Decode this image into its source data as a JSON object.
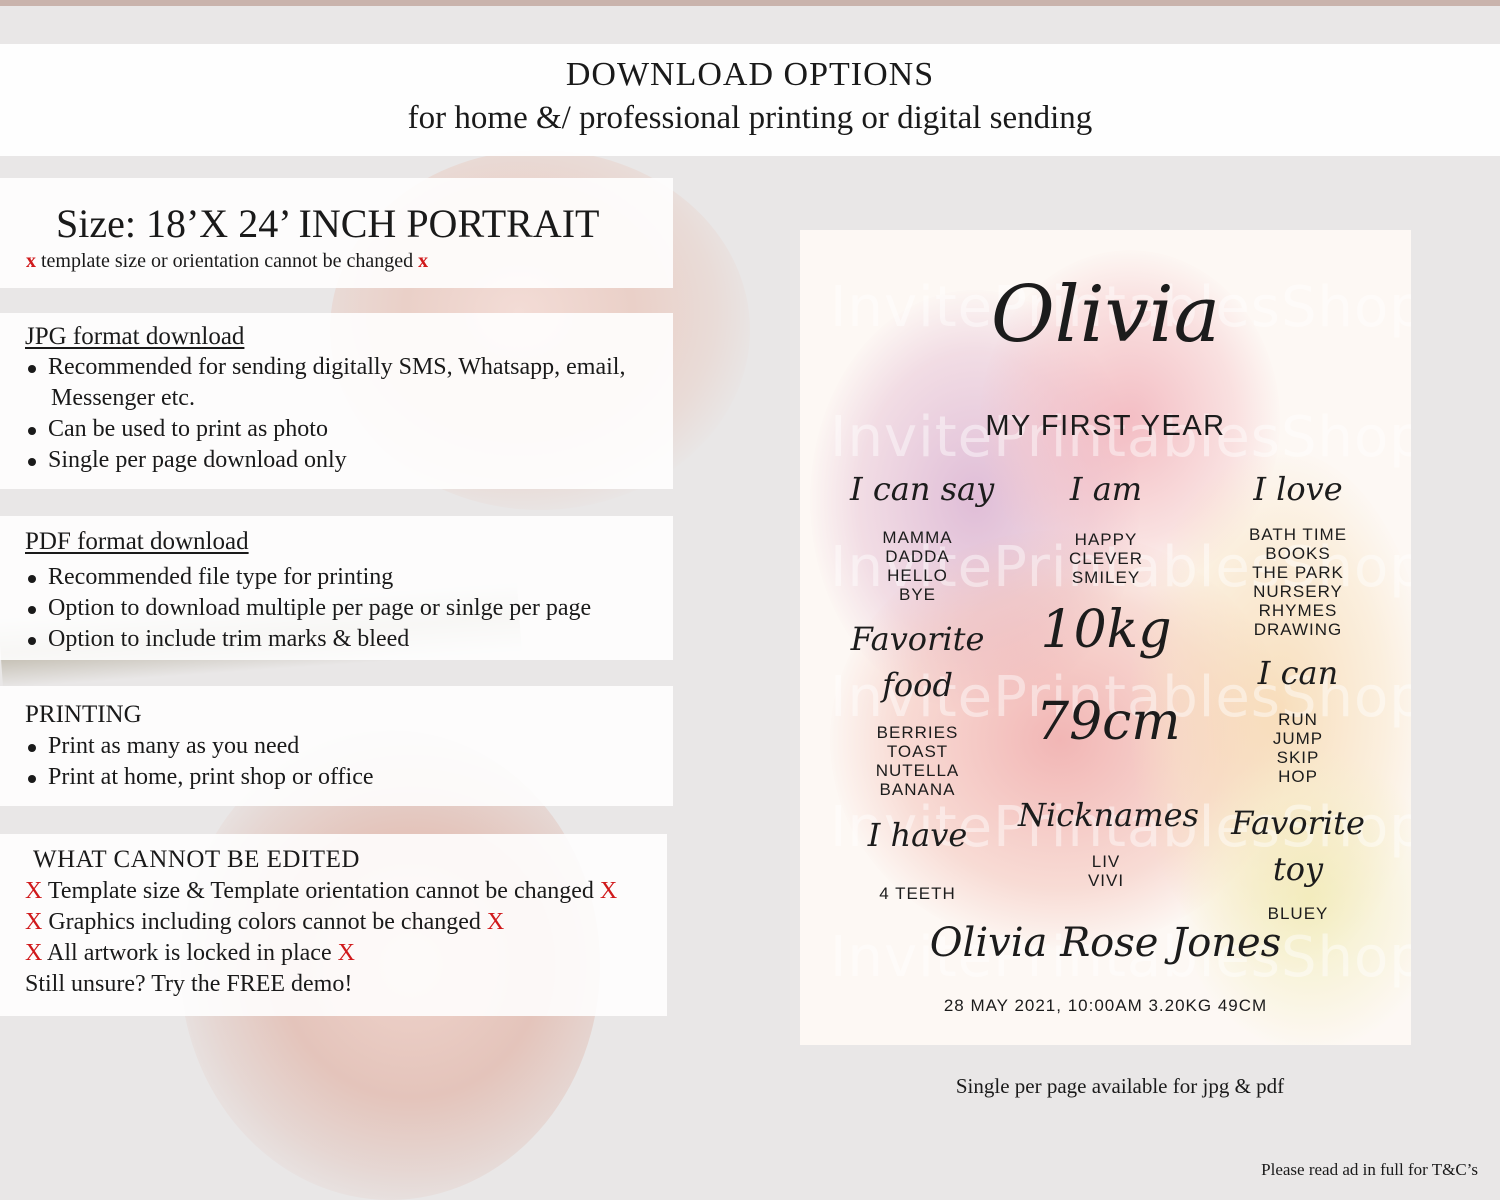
{
  "header": {
    "title": "DOWNLOAD OPTIONS",
    "subtitle": "for home &/ professional printing or digital sending"
  },
  "size_panel": {
    "title": "Size: 18’X 24’ INCH PORTRAIT",
    "mark": "x",
    "note": "template size or orientation cannot be changed"
  },
  "jpg_panel": {
    "title": "JPG format download",
    "items": [
      "Recommended for sending digitally SMS, Whatsapp, email,",
      "Messenger etc.",
      "Can be used to print as photo",
      "Single per page download only"
    ]
  },
  "pdf_panel": {
    "title": "PDF format download",
    "items": [
      "Recommended file type for printing",
      "Option to download multiple per page or sinlge per page",
      "Option to include trim marks & bleed"
    ]
  },
  "printing_panel": {
    "title": "PRINTING",
    "items": [
      "Print as many as you need",
      "Print at home, print shop or office"
    ]
  },
  "edit_panel": {
    "title": "WHAT CANNOT BE EDITED",
    "mark": "X",
    "items": [
      "Template size & Template orientation cannot be changed",
      "Graphics including colors cannot be changed",
      "All artwork is locked in place"
    ],
    "closing": "Still unsure? Try the FREE demo!"
  },
  "poster": {
    "watermark": "InvitePrintablesShop",
    "name": "Olivia",
    "subtitle": "MY FIRST YEAR",
    "i_can_say": {
      "heading": "I can say",
      "items": [
        "MAMMA",
        "DADDA",
        "HELLO",
        "BYE"
      ]
    },
    "i_am": {
      "heading": "I am",
      "items": [
        "HAPPY",
        "CLEVER",
        "SMILEY"
      ]
    },
    "i_love": {
      "heading": "I love",
      "items": [
        "BATH TIME",
        "BOOKS",
        "THE PARK",
        "NURSERY",
        "RHYMES",
        "DRAWING"
      ]
    },
    "weight": "10kg",
    "height": "79cm",
    "favorite_food": {
      "heading_line1": "Favorite",
      "heading_line2": "food",
      "items": [
        "BERRIES",
        "TOAST",
        "NUTELLA",
        "BANANA"
      ]
    },
    "i_can": {
      "heading": "I can",
      "items": [
        "RUN",
        "JUMP",
        "SKIP",
        "HOP"
      ]
    },
    "i_have": {
      "heading": "I have",
      "items": [
        "4 TEETH"
      ]
    },
    "nicknames": {
      "heading": "Nicknames",
      "items": [
        "LIV",
        "VIVI"
      ]
    },
    "favorite_toy": {
      "heading_line1": "Favorite",
      "heading_line2": "toy",
      "items": [
        "BLUEY"
      ]
    },
    "full_name": "Olivia Rose Jones",
    "birth_details": "28 MAY 2021, 10:00AM 3.20KG 49CM"
  },
  "caption": "Single per page available for jpg & pdf",
  "footnote": "Please read ad in full for T&C’s",
  "colors": {
    "mark_red": "#d0191b",
    "panel_white": "#ffffff",
    "background": "#e9e7e7"
  }
}
